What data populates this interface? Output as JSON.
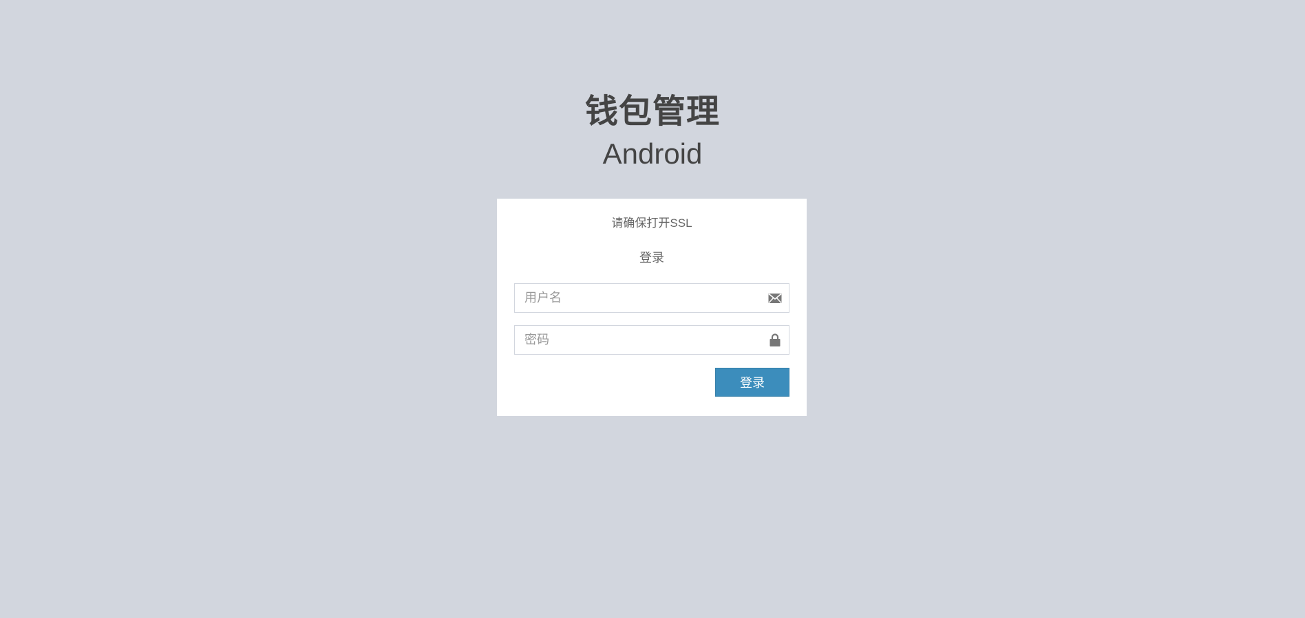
{
  "logo": {
    "title": "钱包管理",
    "subtitle": "Android"
  },
  "login_box": {
    "notice": "请确保打开SSL",
    "box_msg": "登录",
    "username": {
      "placeholder": "用户名",
      "value": "",
      "icon": "envelope-icon"
    },
    "password": {
      "placeholder": "密码",
      "value": "",
      "icon": "lock-icon"
    },
    "submit_label": "登录"
  },
  "colors": {
    "page_background": "#d2d6de",
    "box_background": "#ffffff",
    "button_primary": "#3c8dbc",
    "text_dark": "#444444",
    "icon": "#777777"
  }
}
